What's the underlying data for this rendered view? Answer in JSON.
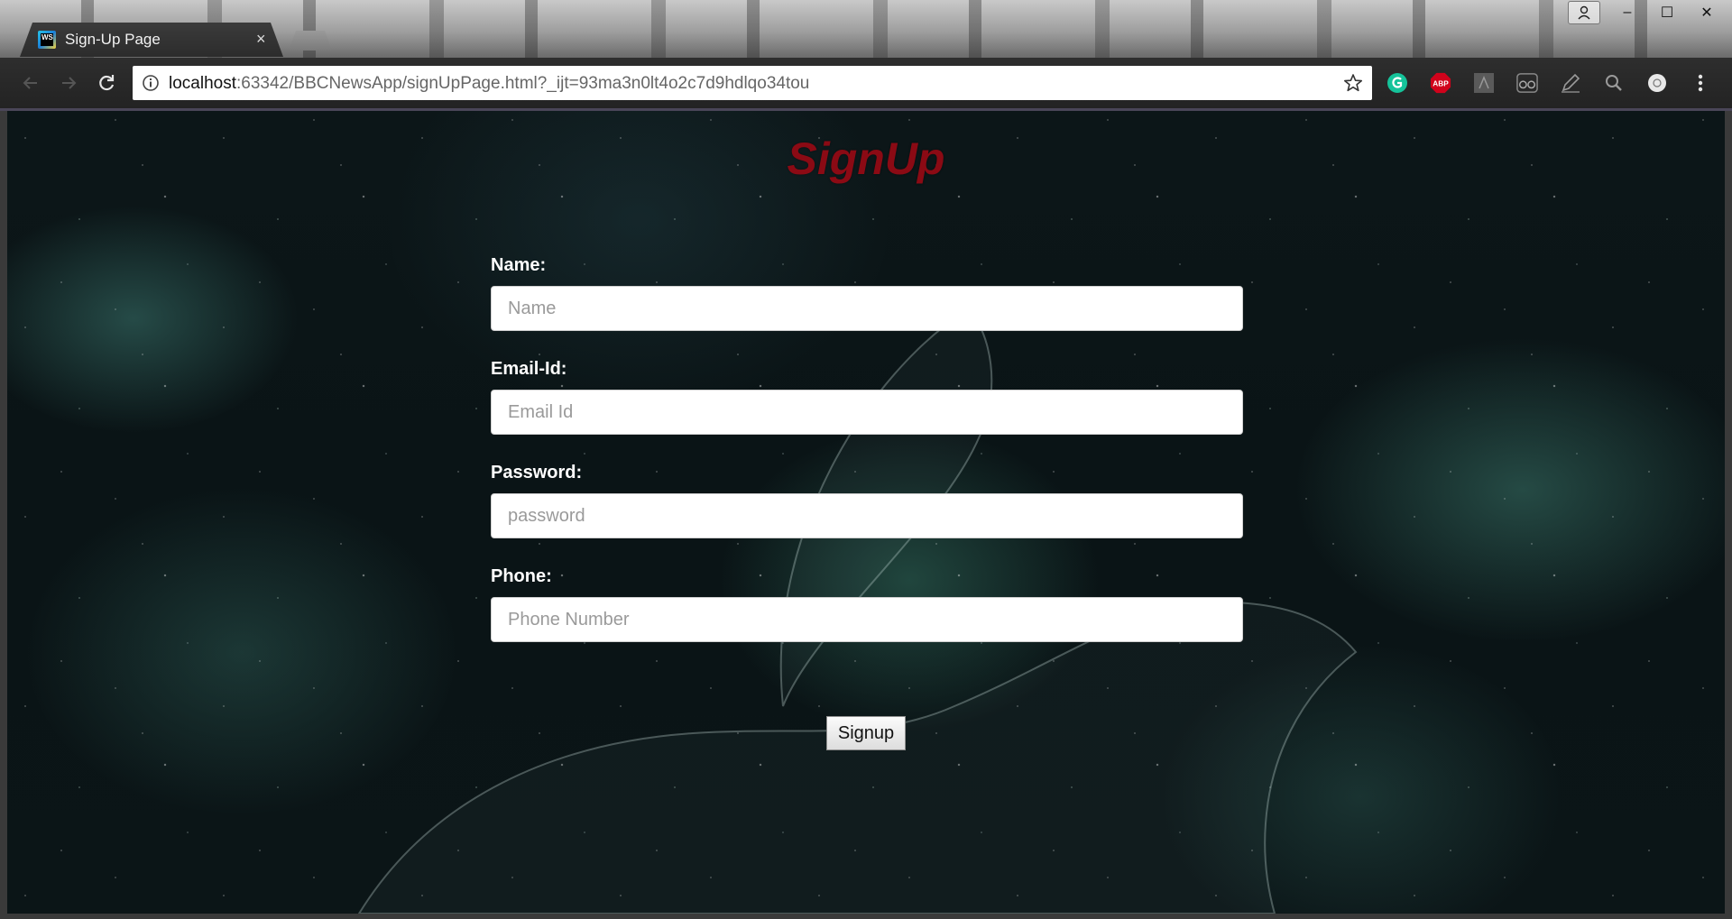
{
  "browser": {
    "tab": {
      "title": "Sign-Up Page",
      "icon": "webstorm-icon",
      "icon_text": "WS",
      "close_glyph": "×"
    },
    "window_controls": {
      "minimize_glyph": "–",
      "maximize_glyph": "☐",
      "close_glyph": "✕"
    },
    "address_bar": {
      "host": "localhost",
      "rest": ":63342/BBCNewsApp/signUpPage.html?_ijt=93ma3n0lt4o2c7d9hdlqo34tou"
    },
    "extensions": [
      {
        "name": "grammarly-icon",
        "label": "G",
        "color": "#15c39a"
      },
      {
        "name": "adblock-plus-icon",
        "label": "ABP",
        "color": "#d0021b"
      },
      {
        "name": "acrobat-icon",
        "label": "",
        "color": "#5a5a5a"
      },
      {
        "name": "glasses-icon",
        "label": "",
        "color": "#6a6a6a"
      },
      {
        "name": "pen-icon",
        "label": "",
        "color": "#8a8a8a"
      },
      {
        "name": "search-icon",
        "label": "",
        "color": "#8a8a8a"
      },
      {
        "name": "circle-extension-icon",
        "label": "",
        "color": "#e8e8e8"
      }
    ]
  },
  "page": {
    "heading": "SignUp",
    "heading_color": "#8b0a14",
    "fields": [
      {
        "label": "Name:",
        "placeholder": "Name",
        "value": ""
      },
      {
        "label": "Email-Id:",
        "placeholder": "Email Id",
        "value": ""
      },
      {
        "label": "Password:",
        "placeholder": "password",
        "value": ""
      },
      {
        "label": "Phone:",
        "placeholder": "Phone Number",
        "value": ""
      }
    ],
    "submit_label": "Signup"
  }
}
